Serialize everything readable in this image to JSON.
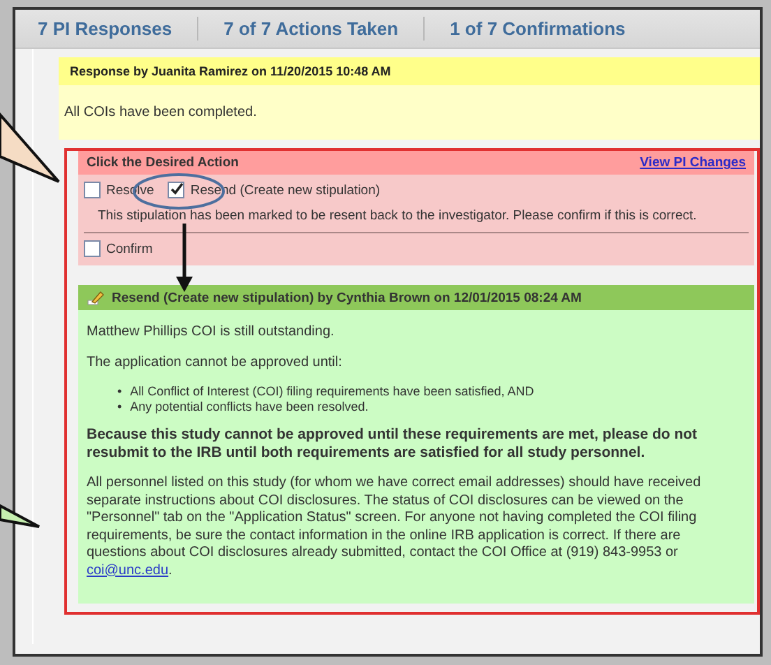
{
  "tabs": [
    {
      "label": "7 PI Responses",
      "selected": false
    },
    {
      "label": "7 of 7 Actions Taken",
      "selected": false
    },
    {
      "label": "1 of 7 Confirmations",
      "selected": false
    }
  ],
  "response": {
    "header": "Response by Juanita Ramirez on 11/20/2015 10:48 AM",
    "body": "All COIs have been completed."
  },
  "action_panel": {
    "title": "Click the Desired Action",
    "link": "View PI Changes",
    "options": [
      {
        "label": "Resolve",
        "checked": false
      },
      {
        "label": "Resend (Create new stipulation)",
        "checked": true
      }
    ],
    "message": "This stipulation has been marked to be resent back to the investigator. Please confirm if this is correct.",
    "confirm": {
      "label": "Confirm",
      "checked": false
    }
  },
  "stipulation": {
    "header": "Resend (Create new stipulation) by Cynthia Brown on 12/01/2015 08:24 AM",
    "blocks": [
      {
        "kind": "text",
        "text": "Matthew Phillips COI is still outstanding."
      },
      {
        "kind": "text",
        "text": "The application cannot be approved until:"
      },
      {
        "kind": "list",
        "items": [
          {
            "marker": "•",
            "text": "All Conflict of Interest (COI) filing requirements have been satisfied, AND"
          },
          {
            "marker": "•",
            "text": "Any potential conflicts have been resolved."
          }
        ]
      },
      {
        "kind": "strong",
        "text": "Because this study cannot be approved until these requirements are met, please do not resubmit to the IRB until both requirements are satisfied for all study personnel."
      },
      {
        "kind": "text_link",
        "text": "All personnel listed on this study (for whom we have correct email addresses) should have received separate instructions about COI disclosures. The status of COI disclosures can be viewed on the \"Personnel\" tab on the \"Application Status\" screen. For anyone not having completed the COI filing requirements, be sure the contact information in the online IRB application is correct. If there are questions about COI disclosures already submitted, contact the COI Office at (919) 843-9953 or",
        "link": "coi@unc.edu",
        "after": "."
      }
    ]
  }
}
